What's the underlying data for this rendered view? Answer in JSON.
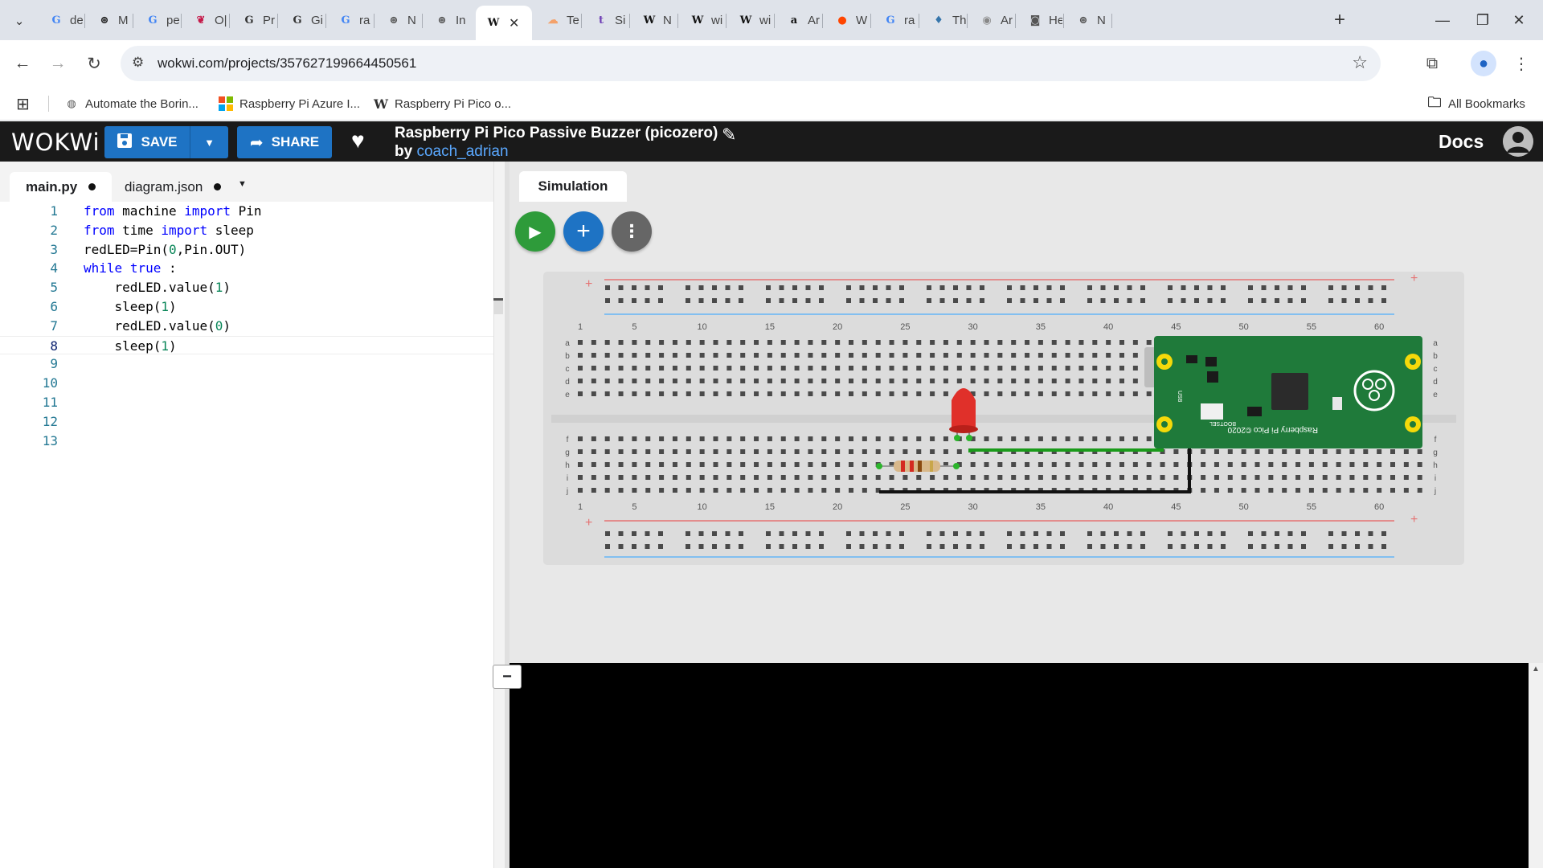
{
  "browser": {
    "tabs": [
      {
        "title": "de",
        "icon": "google-icon",
        "color": "#4285f4",
        "glyph": "G"
      },
      {
        "title": "M",
        "icon": "openai-icon",
        "color": "#222222",
        "glyph": "⊛"
      },
      {
        "title": "pe",
        "icon": "google-icon",
        "color": "#4285f4",
        "glyph": "G"
      },
      {
        "title": "O|",
        "icon": "raspberry-pi-icon",
        "color": "#c51a4a",
        "glyph": "❦"
      },
      {
        "title": "Pr",
        "icon": "g-letter-icon",
        "color": "#333333",
        "glyph": "G"
      },
      {
        "title": "Gi",
        "icon": "g-letter-icon",
        "color": "#333333",
        "glyph": "G"
      },
      {
        "title": "ra",
        "icon": "google-icon",
        "color": "#4285f4",
        "glyph": "G"
      },
      {
        "title": "N",
        "icon": "chatgpt-icon",
        "color": "#555555",
        "glyph": "⊛"
      },
      {
        "title": "In",
        "icon": "chatgpt-icon",
        "color": "#555555",
        "glyph": "⊛"
      },
      {
        "title": "",
        "icon": "wokwi-icon",
        "color": "#111111",
        "glyph": "W",
        "active": true
      },
      {
        "title": "Te",
        "icon": "cloud-icon",
        "color": "#f4a26b",
        "glyph": "☁"
      },
      {
        "title": "Si",
        "icon": "tumblr-icon",
        "color": "#6f3fb5",
        "glyph": "t"
      },
      {
        "title": "N",
        "icon": "wikipedia-icon",
        "color": "#111111",
        "glyph": "W"
      },
      {
        "title": "wi",
        "icon": "wikipedia-icon",
        "color": "#111111",
        "glyph": "W"
      },
      {
        "title": "wi",
        "icon": "wikipedia-icon",
        "color": "#111111",
        "glyph": "W"
      },
      {
        "title": "Ar",
        "icon": "amazon-icon",
        "color": "#111111",
        "glyph": "a"
      },
      {
        "title": "W",
        "icon": "reddit-icon",
        "color": "#ff4500",
        "glyph": "●"
      },
      {
        "title": "ra",
        "icon": "google-icon",
        "color": "#4285f4",
        "glyph": "G"
      },
      {
        "title": "Th",
        "icon": "python-icon",
        "color": "#3776ab",
        "glyph": "♦"
      },
      {
        "title": "Ar",
        "icon": "bird-icon",
        "color": "#888888",
        "glyph": "◉"
      },
      {
        "title": "He",
        "icon": "robot-icon",
        "color": "#555555",
        "glyph": "◙"
      },
      {
        "title": "N",
        "icon": "chatgpt-icon",
        "color": "#555555",
        "glyph": "⊛"
      }
    ],
    "url": "wokwi.com/projects/357627199664450561",
    "bookmarks": [
      {
        "label": "Automate the Borin...",
        "icon": "globe-icon"
      },
      {
        "label": "Raspberry Pi Azure I...",
        "icon": "microsoft-icon"
      },
      {
        "label": "Raspberry Pi Pico o...",
        "icon": "wikipedia-icon"
      }
    ],
    "all_bookmarks": "All Bookmarks"
  },
  "header": {
    "logo": "WOKWi",
    "save_label": "SAVE",
    "share_label": "SHARE",
    "project_title": "Raspberry Pi Pico Passive Buzzer (picozero)",
    "by_label": "by",
    "author": "coach_adrian",
    "docs_label": "Docs"
  },
  "editor": {
    "tabs": [
      {
        "label": "main.py",
        "modified": true,
        "active": true
      },
      {
        "label": "diagram.json",
        "modified": true,
        "active": false
      }
    ],
    "code_lines": [
      "from machine import Pin",
      "from time import sleep",
      "redLED=Pin(0,Pin.OUT)",
      "while true :",
      "    redLED.value(1)",
      "    sleep(1)",
      "    redLED.value(0)",
      "    sleep(1)",
      "",
      "",
      "",
      "",
      ""
    ],
    "current_line": 8
  },
  "simulation": {
    "tab_label": "Simulation",
    "breadboard": {
      "column_numbers": [
        "1",
        "5",
        "10",
        "15",
        "20",
        "25",
        "30",
        "35",
        "40",
        "45",
        "50",
        "55",
        "60"
      ],
      "row_letters_top": [
        "a",
        "b",
        "c",
        "d",
        "e"
      ],
      "row_letters_bottom": [
        "f",
        "g",
        "h",
        "i",
        "j"
      ],
      "plus_sign": "+"
    },
    "pico": {
      "label": "Raspberry Pi Pico ©2020",
      "bootsel": "BOOTSEL",
      "usb": "USB"
    }
  },
  "colors": {
    "wokwi_header": "#1a1a1a",
    "save_blue": "#1e73c4",
    "play_green": "#2e9b3a",
    "pico_green": "#1f7a3a",
    "led_red": "#e0302a",
    "wire_green": "#1a9a1a",
    "wire_black": "#111111"
  }
}
